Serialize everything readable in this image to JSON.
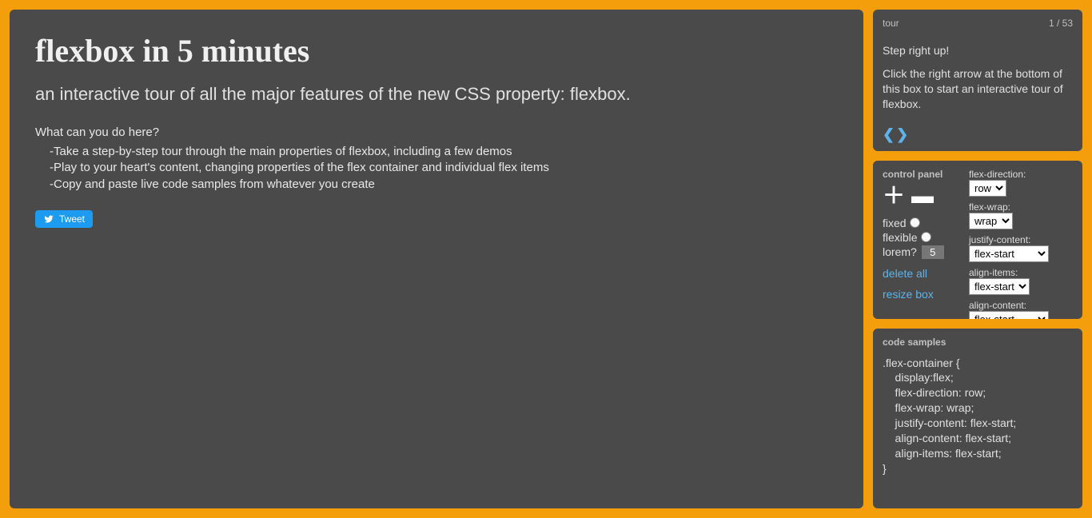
{
  "main": {
    "title": "flexbox in 5 minutes",
    "subtitle": "an interactive tour of all the major features of the new CSS property: flexbox.",
    "question": "What can you do here?",
    "bullets": [
      "-Take a step-by-step tour through the main properties of flexbox, including a few demos",
      "-Play to your heart's content, changing properties of the flex container and individual flex items",
      "-Copy and paste live code samples from whatever you create"
    ],
    "tweet_label": "Tweet"
  },
  "tour": {
    "header": "tour",
    "step_counter": "1 / 53",
    "line1": "Step right up!",
    "line2": "Click the right arrow at the bottom of this box to start an interactive tour of flexbox."
  },
  "control": {
    "header": "control panel",
    "fixed_label": "fixed",
    "flexible_label": "flexible",
    "lorem_label": "lorem?",
    "lorem_value": "5",
    "delete_all": "delete all",
    "resize_box": "resize box",
    "props": {
      "flex_direction": {
        "label": "flex-direction:",
        "value": "row"
      },
      "flex_wrap": {
        "label": "flex-wrap:",
        "value": "wrap"
      },
      "justify_content": {
        "label": "justify-content:",
        "value": "flex-start"
      },
      "align_items": {
        "label": "align-items:",
        "value": "flex-start"
      },
      "align_content": {
        "label": "align-content:",
        "value": "flex-start"
      }
    }
  },
  "code": {
    "header": "code samples",
    "sample": ".flex-container {\n    display:flex;\n    flex-direction: row;\n    flex-wrap: wrap;\n    justify-content: flex-start;\n    align-content: flex-start;\n    align-items: flex-start;\n}"
  }
}
